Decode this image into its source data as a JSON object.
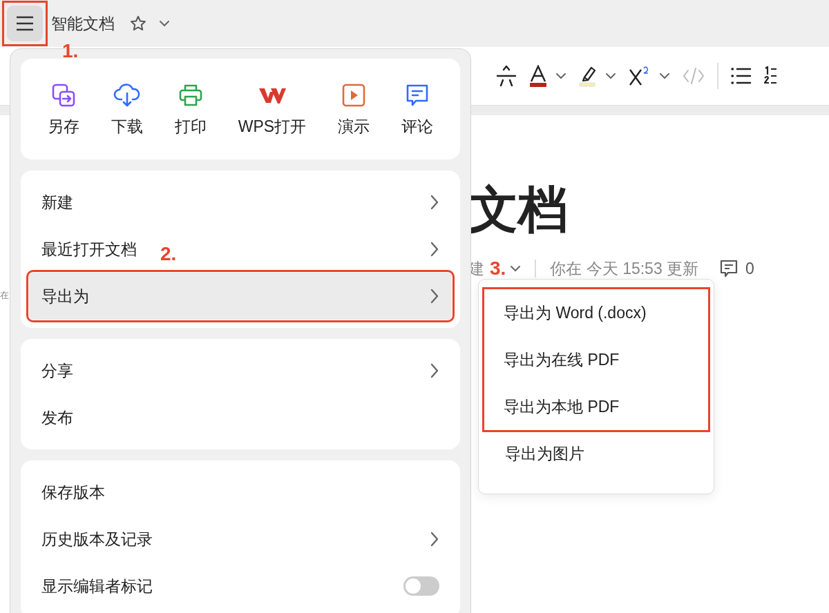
{
  "top_bar": {
    "menu_button": {
      "active": true,
      "annotated": true,
      "note": "1."
    },
    "title": "智能文档"
  },
  "toolbar": {
    "tools": [
      {
        "kind": "strikethrough",
        "caret": false
      },
      {
        "kind": "font_color",
        "caret": true
      },
      {
        "kind": "highlight",
        "caret": true
      },
      {
        "kind": "superscript",
        "caret": true
      },
      {
        "kind": "code",
        "caret": false
      },
      {
        "kind": "divider",
        "caret": false
      },
      {
        "kind": "bullet_list",
        "caret": false
      },
      {
        "kind": "numbered_list",
        "caret": false
      }
    ]
  },
  "document": {
    "side_fragment": "在",
    "title": "文档",
    "meta": {
      "author_fragment": "建",
      "note": "3.",
      "updated": "你在 今天 15:53 更新",
      "comment_count": "0"
    }
  },
  "menu": {
    "quick_actions": [
      {
        "kind": "save_as",
        "label": "另存"
      },
      {
        "kind": "download",
        "label": "下载"
      },
      {
        "kind": "print",
        "label": "打印"
      },
      {
        "kind": "wps",
        "label": "WPS打开"
      },
      {
        "kind": "present",
        "label": "演示"
      },
      {
        "kind": "comment",
        "label": "评论"
      }
    ],
    "groups": [
      [
        {
          "label": "新建",
          "kind": "submenu",
          "selected": false,
          "annotated": false
        },
        {
          "label": "最近打开文档",
          "kind": "submenu",
          "selected": false,
          "annotated": false,
          "note": "2."
        },
        {
          "label": "导出为",
          "kind": "submenu",
          "selected": true,
          "annotated": true
        }
      ],
      [
        {
          "label": "分享",
          "kind": "submenu",
          "selected": false,
          "annotated": false
        },
        {
          "label": "发布",
          "kind": "plain",
          "selected": false,
          "annotated": false
        }
      ],
      [
        {
          "label": "保存版本",
          "kind": "plain",
          "selected": false,
          "annotated": false
        },
        {
          "label": "历史版本及记录",
          "kind": "submenu",
          "selected": false,
          "annotated": false
        },
        {
          "label": "显示编辑者标记",
          "kind": "toggle",
          "on": false,
          "selected": false,
          "annotated": false
        }
      ]
    ]
  },
  "submenu": {
    "items": [
      {
        "label": "导出为 Word (.docx)",
        "annotated": true
      },
      {
        "label": "导出为在线 PDF",
        "annotated": true
      },
      {
        "label": "导出为本地 PDF",
        "annotated": true
      },
      {
        "label": "导出为图片",
        "annotated": false
      }
    ]
  }
}
